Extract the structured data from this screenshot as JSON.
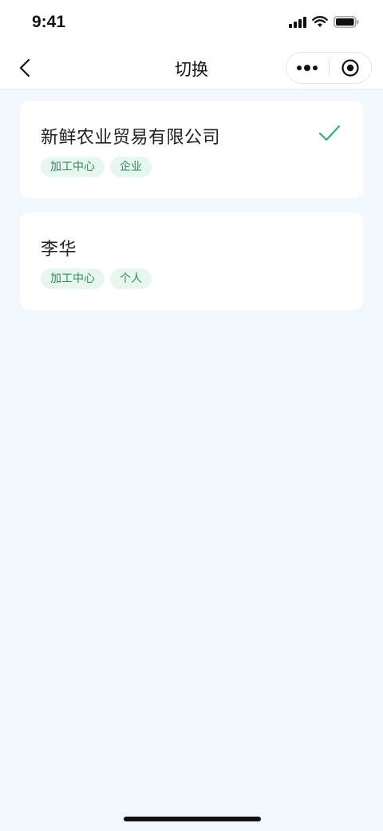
{
  "status_bar": {
    "time": "9:41"
  },
  "nav": {
    "title": "切换"
  },
  "accounts": [
    {
      "name": "新鲜农业贸易有限公司",
      "tags": [
        "加工中心",
        "企业"
      ],
      "selected": true
    },
    {
      "name": "李华",
      "tags": [
        "加工中心",
        "个人"
      ],
      "selected": false
    }
  ],
  "colors": {
    "accent": "#2db36a",
    "tag_bg": "#e7f6ee",
    "tag_text": "#2d8f5a",
    "page_bg": "#f2f7fe"
  }
}
